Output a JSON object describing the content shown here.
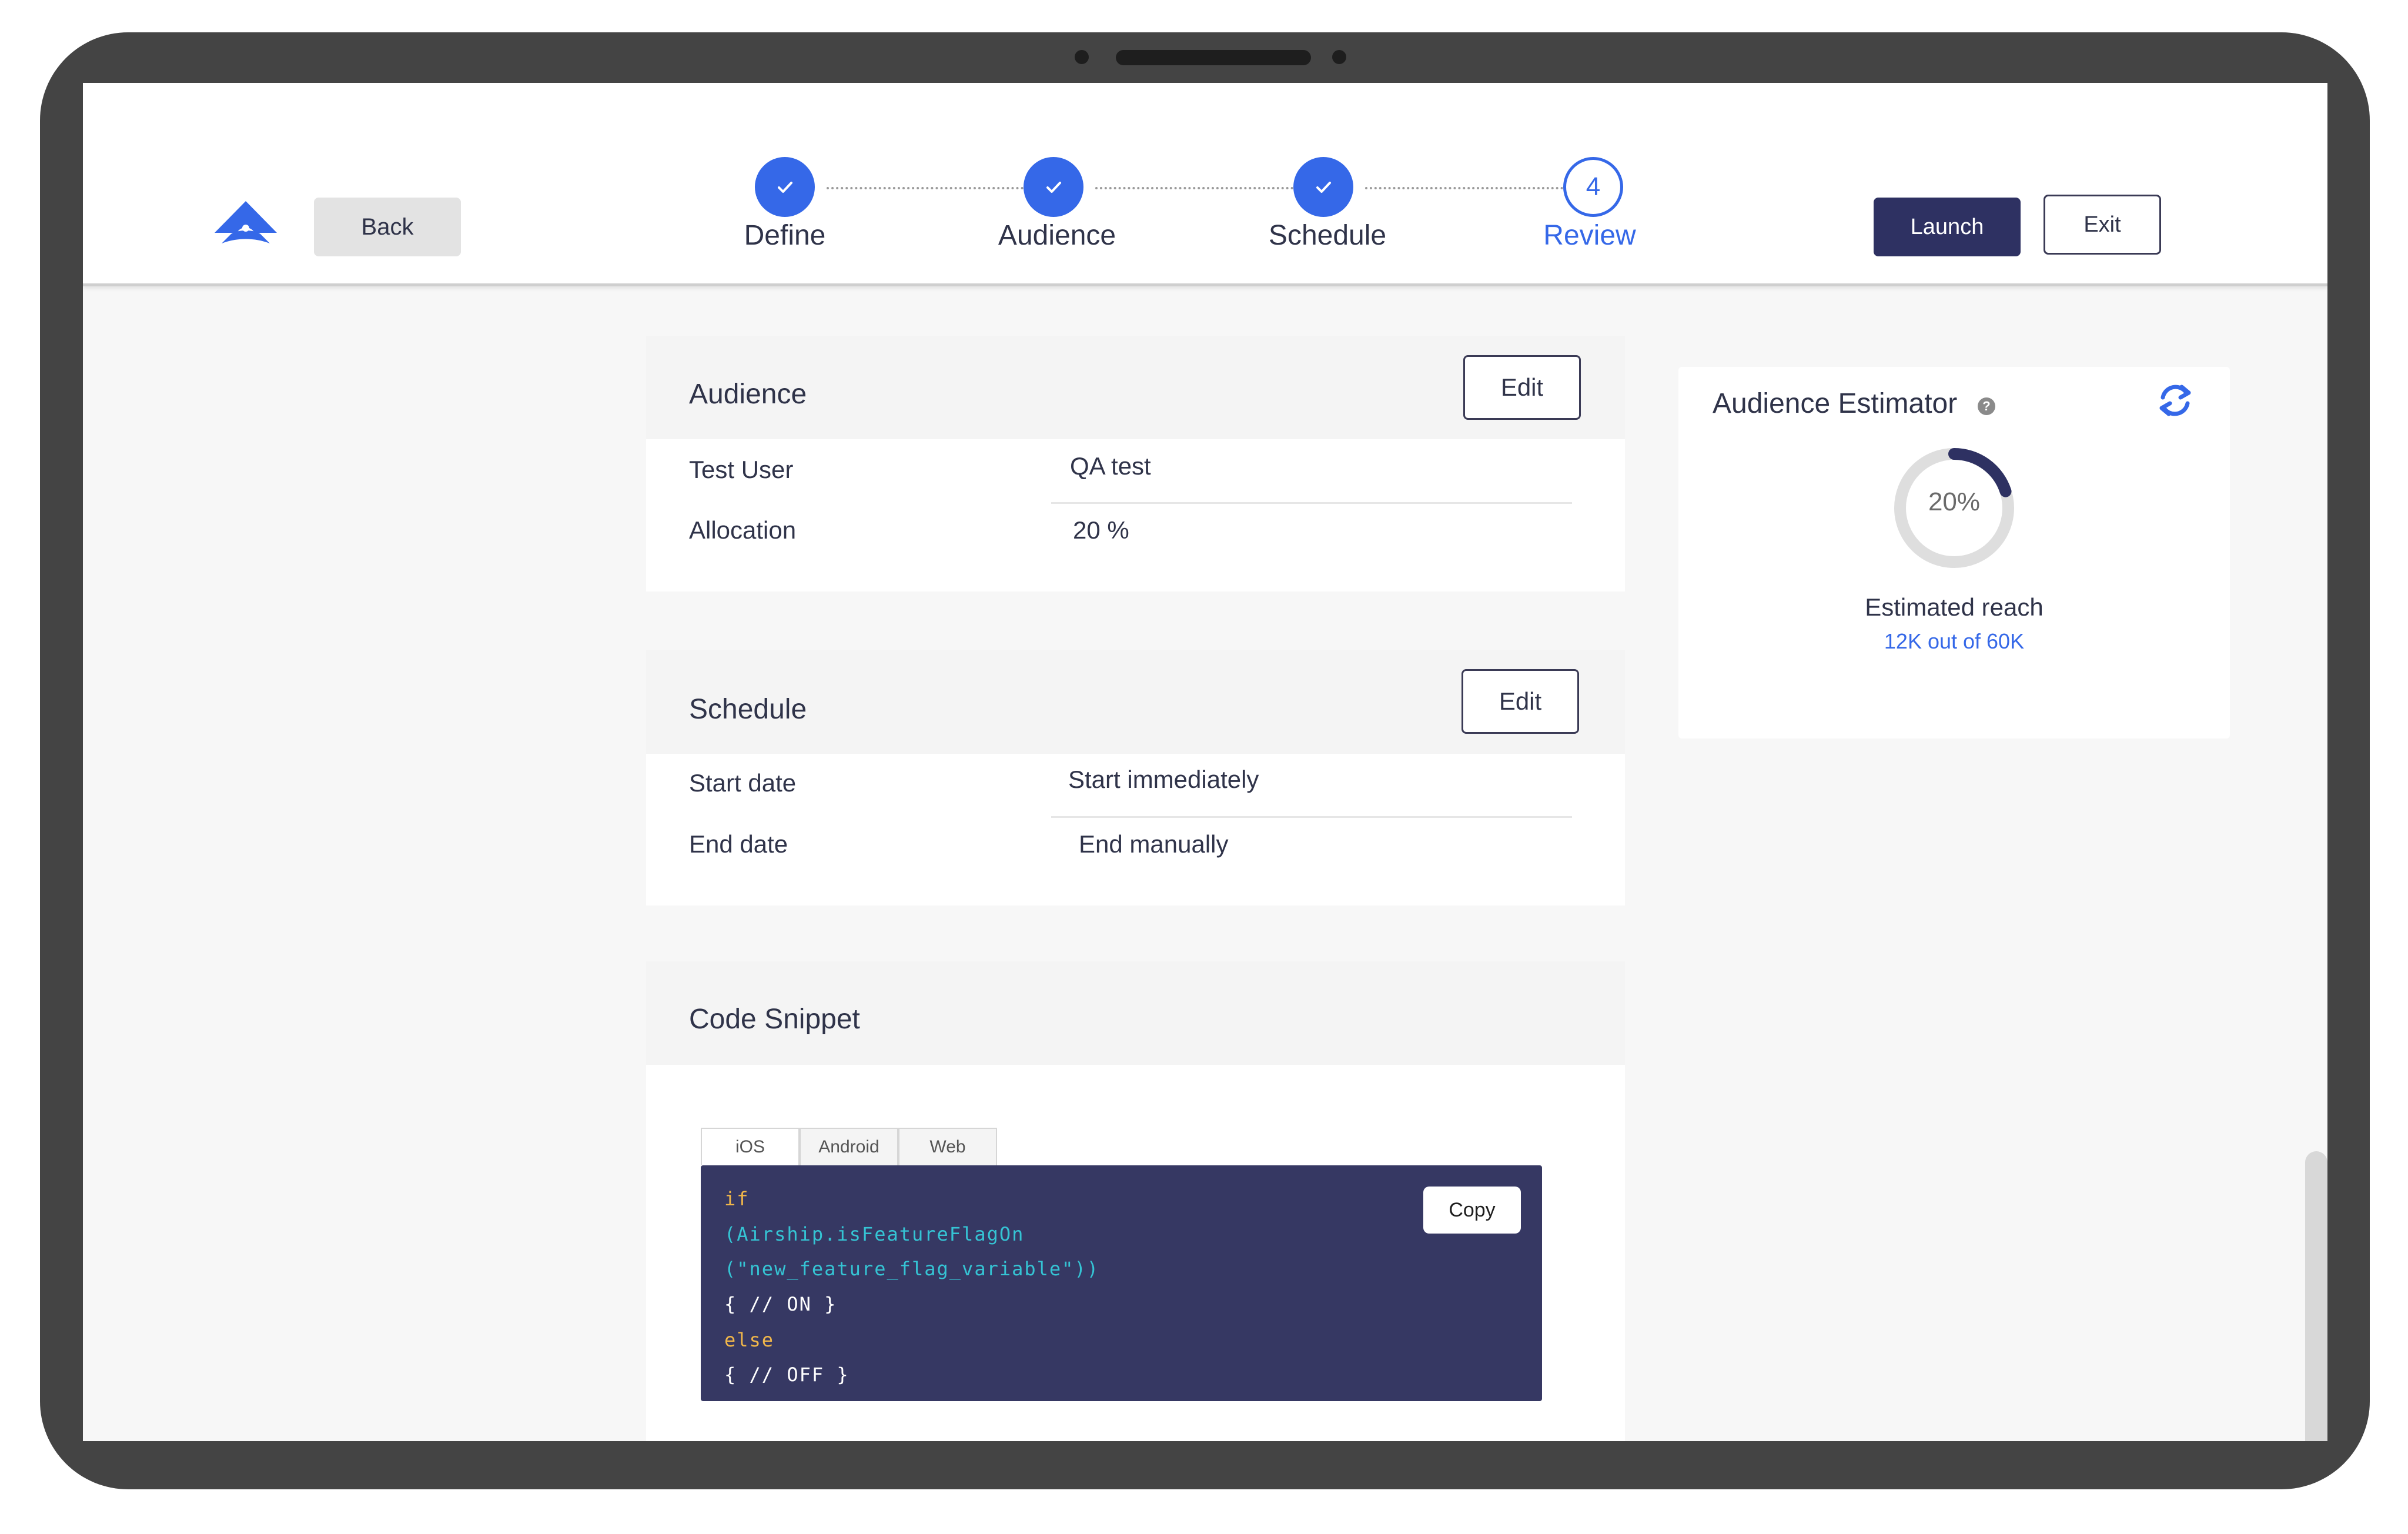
{
  "header": {
    "back_label": "Back",
    "launch_label": "Launch",
    "exit_label": "Exit",
    "steps": [
      {
        "label": "Define",
        "status": "completed",
        "marker": "✓"
      },
      {
        "label": "Audience",
        "status": "completed",
        "marker": "✓"
      },
      {
        "label": "Schedule",
        "status": "completed",
        "marker": "✓"
      },
      {
        "label": "Review",
        "status": "current",
        "marker": "4"
      }
    ]
  },
  "audience": {
    "title": "Audience",
    "edit_label": "Edit",
    "rows": [
      {
        "label": "Test User",
        "value": "QA test"
      },
      {
        "label": "Allocation",
        "value": "20 %"
      }
    ]
  },
  "schedule": {
    "title": "Schedule",
    "edit_label": "Edit",
    "rows": [
      {
        "label": "Start date",
        "value": "Start immediately"
      },
      {
        "label": "End date",
        "value": "End manually"
      }
    ]
  },
  "code_snippet": {
    "title": "Code Snippet",
    "tabs": [
      "iOS",
      "Android",
      "Web"
    ],
    "active_tab": "iOS",
    "copy_label": "Copy",
    "lines": [
      "if",
      "(Airship.isFeatureFlagOn",
      "(\"new_feature_flag_variable\"))",
      "{ // ON }",
      "else",
      "{ // OFF }"
    ]
  },
  "estimator": {
    "title": "Audience Estimator",
    "percent_label": "20%",
    "percent": 20,
    "reach_label": "Estimated reach",
    "reach_value": "12K out of 60K"
  },
  "colors": {
    "accent": "#3568e8",
    "navy": "#2e3162",
    "code_bg": "#363863",
    "keyword": "#f0b64a",
    "function": "#35c4d4"
  },
  "icons": {
    "logo": "airship-logo-icon",
    "check": "check-icon",
    "help": "help-icon",
    "refresh": "refresh-icon"
  }
}
